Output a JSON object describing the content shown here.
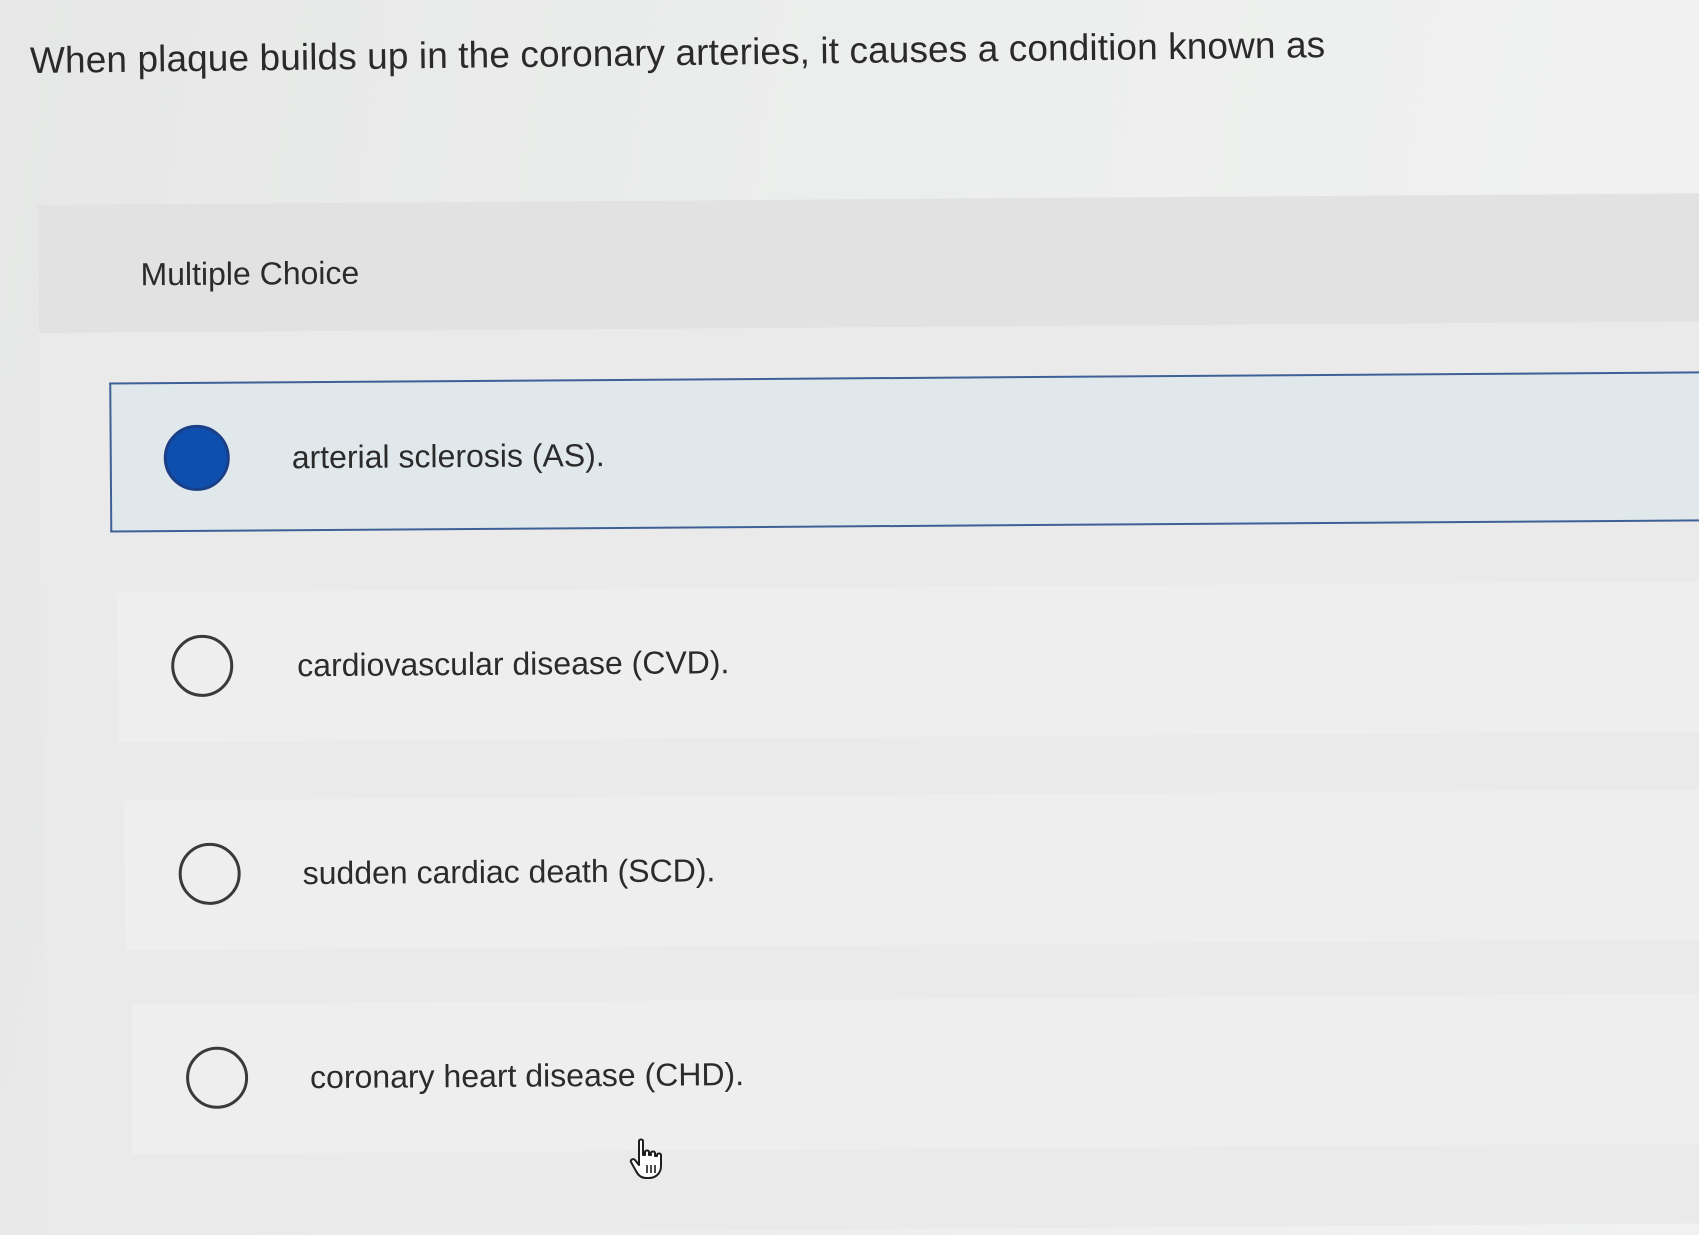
{
  "question": {
    "text": "When plaque builds up in the coronary arteries, it causes a condition known as"
  },
  "multiple_choice": {
    "label": "Multiple Choice",
    "options": [
      {
        "text": "arterial sclerosis (AS).",
        "selected": true
      },
      {
        "text": "cardiovascular disease (CVD).",
        "selected": false
      },
      {
        "text": "sudden cardiac death (SCD).",
        "selected": false
      },
      {
        "text": "coronary heart disease (CHD).",
        "selected": false
      }
    ]
  },
  "colors": {
    "selected_fill": "#0e4fae",
    "selected_border": "#3f6096",
    "selected_background": "#e1e8ec"
  },
  "icons": {
    "cursor": "hand-pointer-icon"
  }
}
